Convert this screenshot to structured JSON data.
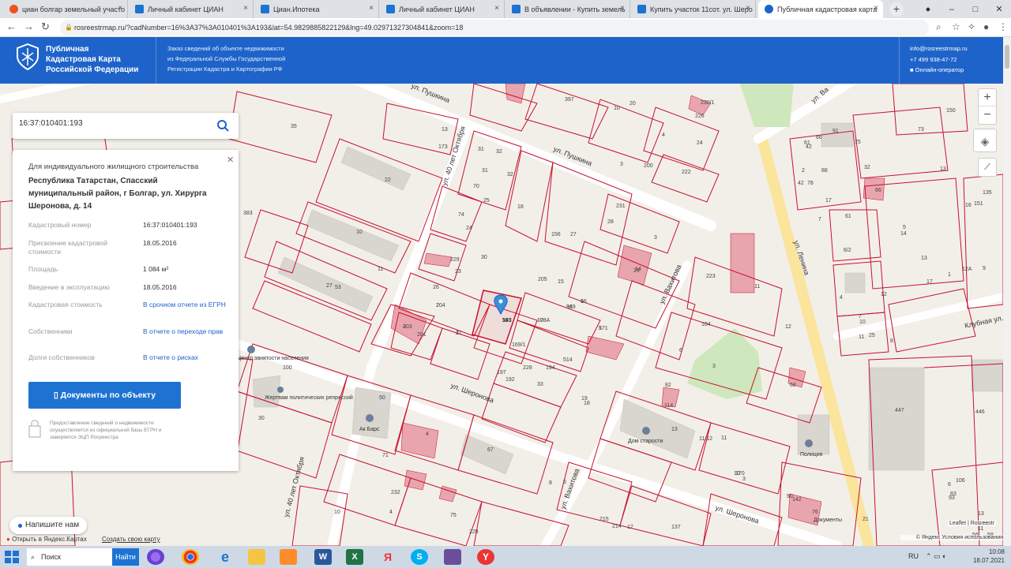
{
  "browser": {
    "tabs": [
      {
        "title": "циан болгар земельный участо",
        "icon_color": "#f25022"
      },
      {
        "title": "Личный кабинет ЦИАН",
        "icon_color": "#1e73d2"
      },
      {
        "title": "Циан.Ипотека",
        "icon_color": "#1e73d2"
      },
      {
        "title": "Личный кабинет ЦИАН",
        "icon_color": "#1e73d2"
      },
      {
        "title": "В объявлении - Купить земель",
        "icon_color": "#1e73d2"
      },
      {
        "title": "Купить участок 11сот. ул. Шеро",
        "icon_color": "#1e73d2"
      },
      {
        "title": "Публичная кадастровая карта",
        "icon_color": "#1e63c9"
      }
    ],
    "url": "rosreestrmap.ru/?cadNumber=16%3A37%3A010401%3A193&lat=54.9829885822129&lng=49.02971327304841&zoom=18",
    "new_tab": "+"
  },
  "header": {
    "title_lines": [
      "Публичная",
      "Кадастровая Карта",
      "Российской Федерации"
    ],
    "desc_lines": [
      "Заказ сведений об объекте недвижимости",
      "из Федеральной Службы Государственной",
      "Регистрации Кадастра и Картографии РФ"
    ],
    "email": "info@rosreestrmap.ru",
    "phone": "+7 499 938-47-72",
    "operator": "Онлайн-оператор"
  },
  "search": {
    "value": "16:37:010401:193"
  },
  "panel": {
    "type": "Для индивидуального жилищного строительства",
    "address": "Республика Татарстан, Спасский муниципальный район, г Болгар, ул. Хирурга Шеронова, д. 14",
    "rows": [
      {
        "label": "Кадастровый номер",
        "value": "16:37:010401:193",
        "link": false
      },
      {
        "label": "Присвоение кадастровой стоимости",
        "value": "18.05.2016",
        "link": false
      },
      {
        "label": "Площадь",
        "value": "1 084 м²",
        "link": false
      },
      {
        "label": "Введение в эксплуатацию",
        "value": "18.05.2016",
        "link": false
      },
      {
        "label": "Кадастровая стоимость",
        "value": "В срочном отчете из ЕГРН",
        "link": true
      },
      {
        "label": "Собственники",
        "value": "В отчете о переходе прав",
        "link": true
      },
      {
        "label": "Долги собственников",
        "value": "В отчете о рисках",
        "link": true
      }
    ],
    "doc_button": "Документы по объекту",
    "note": "Предоставление сведений о недвижимости осуществляется из официальной базы ЕГРН и заверяется ЭЦП Росреестра"
  },
  "map": {
    "streets": [
      "ул. Пушкина",
      "ул. 40 лет Октября",
      "ул. Шеронова",
      "ул. Вахитова",
      "ул. Ленина",
      "Клубная ул.",
      "ул. Шеронова",
      "ул. 40 лет Октября",
      "ул. Вахитова",
      "ул. Пушкина",
      "ул. Ва"
    ],
    "parcels": [
      "193",
      "17",
      "36",
      "16",
      "171",
      "21",
      "204",
      "203",
      "201",
      "26",
      "23",
      "30",
      "229",
      "24",
      "74",
      "25",
      "70",
      "31",
      "32",
      "32",
      "31",
      "18",
      "156",
      "27",
      "231",
      "28",
      "3",
      "29",
      "14",
      "15",
      "205",
      "169/1",
      "197",
      "192",
      "228",
      "194",
      "514",
      "33",
      "19",
      "18",
      "13",
      "173",
      "22",
      "10",
      "383",
      "11",
      "53",
      "27",
      "35",
      "397",
      "10",
      "20",
      "3",
      "200",
      "24",
      "226",
      "230/1",
      "4",
      "222",
      "223",
      "104",
      "6",
      "3",
      "82",
      "68",
      "11",
      "12",
      "66",
      "61",
      "42",
      "75",
      "91",
      "66",
      "78",
      "61",
      "7",
      "2",
      "88",
      "42",
      "17",
      "32",
      "16",
      "135",
      "150",
      "73",
      "13",
      "151",
      "1",
      "17",
      "14",
      "13",
      "12А",
      "9",
      "8",
      "5",
      "7",
      "6/2",
      "4",
      "11",
      "12",
      "10",
      "25",
      "114",
      "13",
      "11.12",
      "11",
      "10",
      "170",
      "3",
      "6",
      "8",
      "56",
      "6",
      "4",
      "75",
      "67",
      "4",
      "71",
      "35",
      "50",
      "30",
      "100",
      "232",
      "10",
      "228",
      "215",
      "214",
      "17",
      "137",
      "142",
      "90",
      "76",
      "93",
      "83",
      "446",
      "447",
      "21",
      "11",
      "13",
      "58",
      "108",
      "106",
      "54",
      "108А",
      "949",
      "6",
      "5",
      "1",
      "2",
      "3"
    ],
    "pois": [
      "Ак Барс",
      "Жертвам политических репрессий",
      "Дом старости",
      "Полиция",
      "Документы",
      "Центр занятости населения"
    ]
  },
  "controls": {
    "zoom_in": "+",
    "zoom_out": "−"
  },
  "bottom": {
    "chat": "Напишите нам",
    "yandex_open": "Открыть в Яндекс.Картах",
    "create_map": "Создать свою карту",
    "attrib": "© Яндекс Условия использования",
    "leaflet": "Leaflet | Rosreestr"
  },
  "taskbar": {
    "search_placeholder": "Поиск",
    "search_go": "Найти",
    "lang": "RU",
    "time": "10:08",
    "date": "18.07.2021"
  },
  "colors": {
    "brand_blue": "#1e63c9",
    "parcel_red": "#c8102e",
    "building_pink": "#e8a5ad",
    "building_gray": "#d9d5cf"
  }
}
